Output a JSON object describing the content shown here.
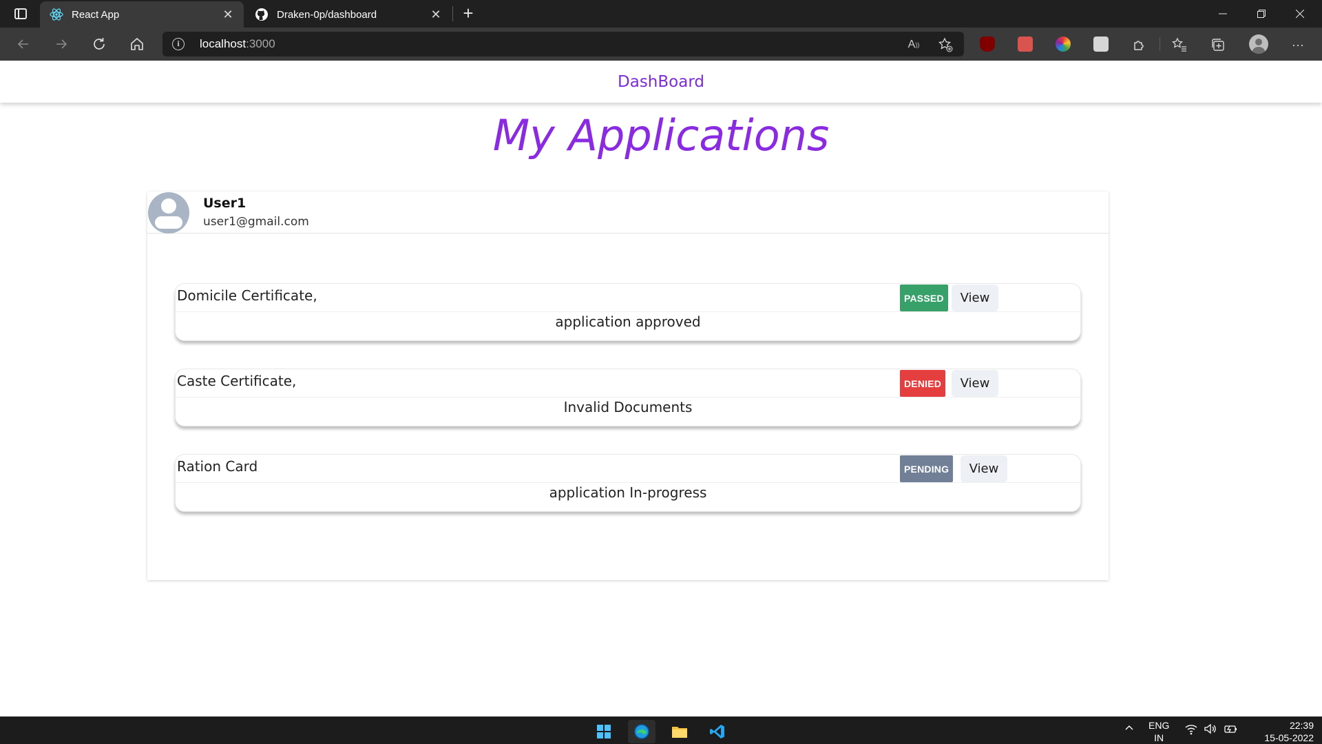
{
  "browser": {
    "tabs": [
      {
        "title": "React App",
        "active": true
      },
      {
        "title": "Draken-0p/dashboard",
        "active": false
      }
    ],
    "address": {
      "host": "localhost",
      "port": ":3000"
    },
    "read_aloud_label": "A",
    "more_label": "···"
  },
  "navbar": {
    "brand": "DashBoard"
  },
  "page": {
    "title": "My Applications"
  },
  "user": {
    "name": "User1",
    "email": "user1@gmail.com"
  },
  "applications": [
    {
      "name": "Domicile Certificate,",
      "status": "PASSED",
      "status_color": "#38a169",
      "note": "application approved",
      "action": "View"
    },
    {
      "name": "Caste Certificate,",
      "status": "DENIED",
      "status_color": "#e53e3e",
      "note": "Invalid Documents",
      "action": "View"
    },
    {
      "name": "Ration Card",
      "status": "PENDING",
      "status_color": "#718096",
      "note": "application In-progress",
      "action": "View"
    }
  ],
  "taskbar": {
    "apps": [
      "start-icon",
      "edge-icon",
      "file-explorer-icon",
      "vscode-icon"
    ],
    "language": "ENG",
    "region": "IN",
    "time": "22:39",
    "date": "15-05-2022"
  },
  "colors": {
    "accent": "#8a2be2",
    "brand": "#7b2cd8"
  }
}
